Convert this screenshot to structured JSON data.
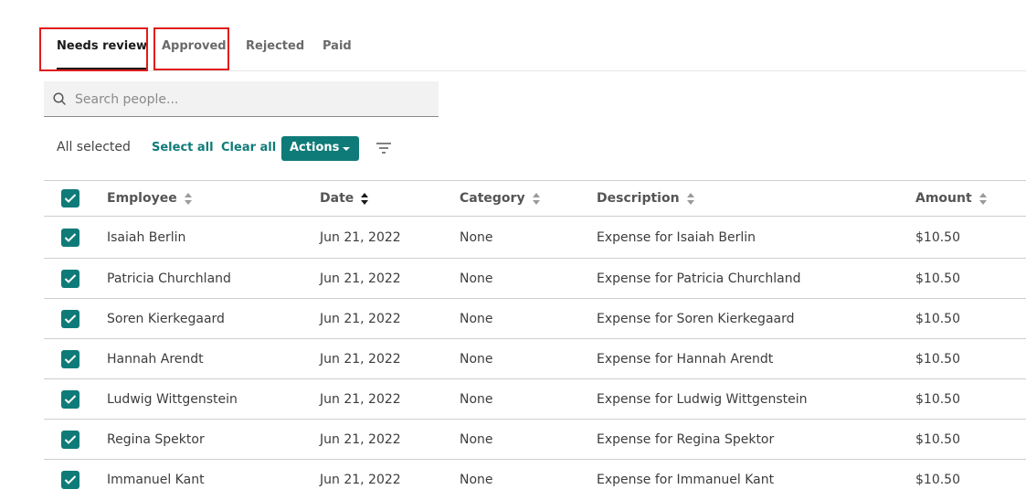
{
  "top_clip": {
    "text": "",
    "link": ""
  },
  "tabs": [
    {
      "label": "Needs review",
      "active": true
    },
    {
      "label": "Approved",
      "active": false
    },
    {
      "label": "Rejected",
      "active": false
    },
    {
      "label": "Paid",
      "active": false
    }
  ],
  "search": {
    "placeholder": "Search people..."
  },
  "toolbar": {
    "selection_status": "All selected",
    "select_all_label": "Select all",
    "clear_all_label": "Clear all",
    "actions_label": "Actions"
  },
  "table": {
    "columns": [
      "Employee",
      "Date",
      "Category",
      "Description",
      "Amount"
    ],
    "rows": [
      {
        "employee": "Isaiah Berlin",
        "date": "Jun 21, 2022",
        "category": "None",
        "description": "Expense for Isaiah Berlin",
        "amount": "$10.50",
        "checked": true
      },
      {
        "employee": "Patricia Churchland",
        "date": "Jun 21, 2022",
        "category": "None",
        "description": "Expense for Patricia Churchland",
        "amount": "$10.50",
        "checked": true
      },
      {
        "employee": "Soren Kierkegaard",
        "date": "Jun 21, 2022",
        "category": "None",
        "description": "Expense for Soren Kierkegaard",
        "amount": "$10.50",
        "checked": true
      },
      {
        "employee": "Hannah Arendt",
        "date": "Jun 21, 2022",
        "category": "None",
        "description": "Expense for Hannah Arendt",
        "amount": "$10.50",
        "checked": true
      },
      {
        "employee": "Ludwig Wittgenstein",
        "date": "Jun 21, 2022",
        "category": "None",
        "description": "Expense for Ludwig Wittgenstein",
        "amount": "$10.50",
        "checked": true
      },
      {
        "employee": "Regina Spektor",
        "date": "Jun 21, 2022",
        "category": "None",
        "description": "Expense for Regina Spektor",
        "amount": "$10.50",
        "checked": true
      },
      {
        "employee": "Immanuel Kant",
        "date": "Jun 21, 2022",
        "category": "None",
        "description": "Expense for Immanuel Kant",
        "amount": "$10.50",
        "checked": true
      }
    ]
  },
  "colors": {
    "accent": "#0f7b78",
    "highlight_box": "#e01b1b",
    "active_tab_underline": "#1a1a1a"
  }
}
